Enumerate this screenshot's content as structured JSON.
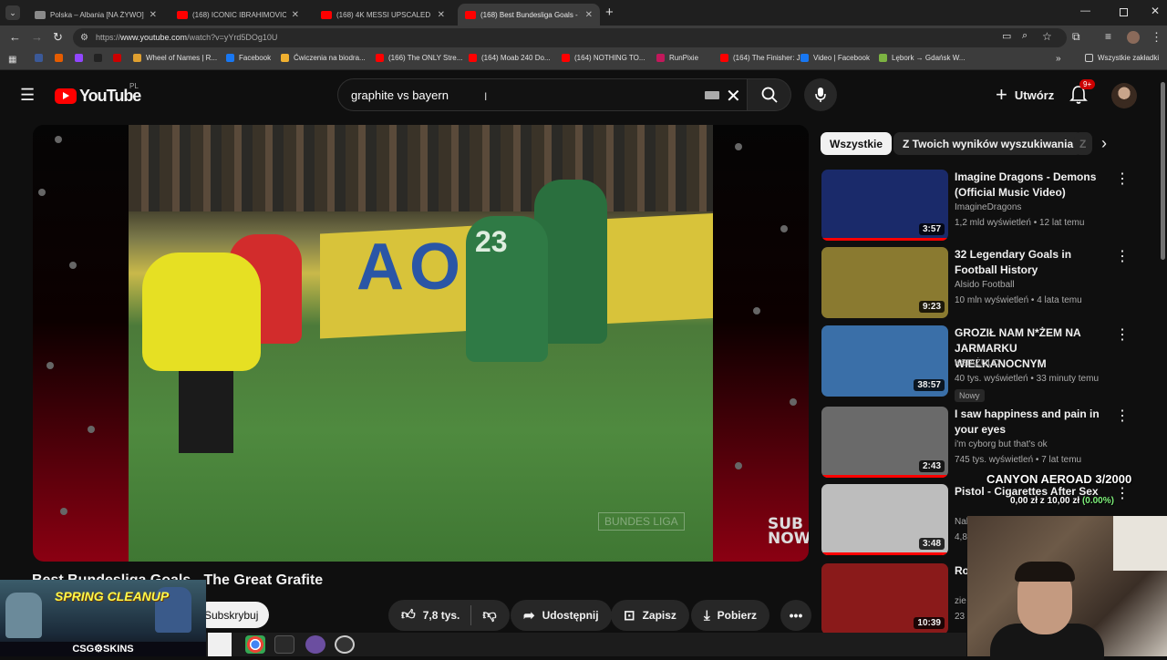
{
  "browser": {
    "tabs": [
      {
        "title": "Polska – Albania [NA ŻYWO]. Tr",
        "active": false
      },
      {
        "title": "(168) ICONIC IBRAHIMOVIC Sc",
        "active": false
      },
      {
        "title": "(168) 4K MESSI UPSCALED CLIP",
        "active": false
      },
      {
        "title": "(168) Best Bundesliga Goals - Th",
        "active": true
      }
    ],
    "url_prefix": "https://",
    "url_host": "www.youtube.com",
    "url_path": "/watch?v=yYrd5DOg10U",
    "bookmarks": [
      {
        "label": "",
        "color": "#3b5998"
      },
      {
        "label": "",
        "color": "#e65c00"
      },
      {
        "label": "",
        "color": "#9146ff"
      },
      {
        "label": "",
        "color": "#222222"
      },
      {
        "label": "",
        "color": "#cc0000"
      },
      {
        "label": "Wheel of Names | R...",
        "color": "#e0a030"
      },
      {
        "label": "Facebook",
        "color": "#1877f2"
      },
      {
        "label": "Ćwiczenia na biodra...",
        "color": "#f0b030"
      },
      {
        "label": "(166) The ONLY Stre...",
        "color": "#ff0000"
      },
      {
        "label": "(164) Moab 240 Do...",
        "color": "#ff0000"
      },
      {
        "label": "(164) NOTHING TO...",
        "color": "#ff0000"
      },
      {
        "label": "RunPixie",
        "color": "#c2185b"
      },
      {
        "label": "(164) The Finisher: J...",
        "color": "#ff0000"
      },
      {
        "label": "Video | Facebook",
        "color": "#1877f2"
      },
      {
        "label": "Lębork → Gdańsk W...",
        "color": "#7cb342"
      }
    ],
    "all_bookmarks": "Wszystkie zakładki"
  },
  "youtube": {
    "logo_text": "YouTube",
    "country_code": "PL",
    "search_query": "graphite vs bayern",
    "create_label": "Utwórz",
    "notif_count": "9+"
  },
  "video": {
    "title": "Best Bundesliga Goals - The Great Grafite",
    "subscribe_label": "Subskrybuj",
    "likes": "7,8 tys.",
    "share_label": "Udostępnij",
    "save_label": "Zapisz",
    "download_label": "Pobierz",
    "ad_text": "AOS",
    "jersey_number": "23",
    "watermark": "BUNDES LIGA",
    "sub_now": "SUB NOW"
  },
  "chips": [
    {
      "label": "Wszystkie",
      "selected": true
    },
    {
      "label": "Z Twoich wyników wyszukiwania",
      "selected": false
    },
    {
      "label": "Z",
      "selected": false
    }
  ],
  "recommendations": [
    {
      "title": "Imagine Dragons - Demons (Official Music Video)",
      "channel": "ImagineDragons",
      "meta": "1,2 mld wyświetleń • 12 lat temu",
      "duration": "3:57",
      "thumb": "#1a2a6a",
      "watched": 1,
      "badge": ""
    },
    {
      "title": "32 Legendary Goals in Football History",
      "channel": "Alsido Football",
      "meta": "10 mln wyświetleń • 4 lata temu",
      "duration": "9:23",
      "thumb": "#8a7a30",
      "watched": 0,
      "badge": ""
    },
    {
      "title": "GROZIŁ NAM N*ŻEM NA JARMARKU WIELKANOCNYM",
      "channel": "KSIĄŻULO",
      "meta": "40 tys. wyświetleń • 33 minuty temu",
      "duration": "38:57",
      "thumb": "#3a6fa8",
      "watched": 0,
      "badge": "Nowy"
    },
    {
      "title": "I saw happiness and pain in your eyes",
      "channel": "i'm cyborg but that's ok",
      "meta": "745 tys. wyświetleń • 7 lat temu",
      "duration": "2:43",
      "thumb": "#6a6a6a",
      "watched": 1,
      "badge": ""
    },
    {
      "title": "Pistol - Cigarettes After Sex",
      "channel": "Naked Dreams",
      "meta": "4,8",
      "duration": "3:48",
      "thumb": "#bdbdbd",
      "watched": 1,
      "badge": ""
    },
    {
      "title": "Ro mi",
      "channel": "zie",
      "meta": "23",
      "duration": "10:39",
      "thumb": "#8a1a1a",
      "watched": 0,
      "badge": ""
    }
  ],
  "stream_overlay": {
    "spring_cleanup": "SPRING CLEANUP",
    "csg_skins": "CSG⚙SKINS",
    "goal_title": "CANYON AEROAD 3/2000",
    "goal_progress": "0,00 zł z 10,00 zł",
    "goal_percent": "(0.00%)"
  }
}
